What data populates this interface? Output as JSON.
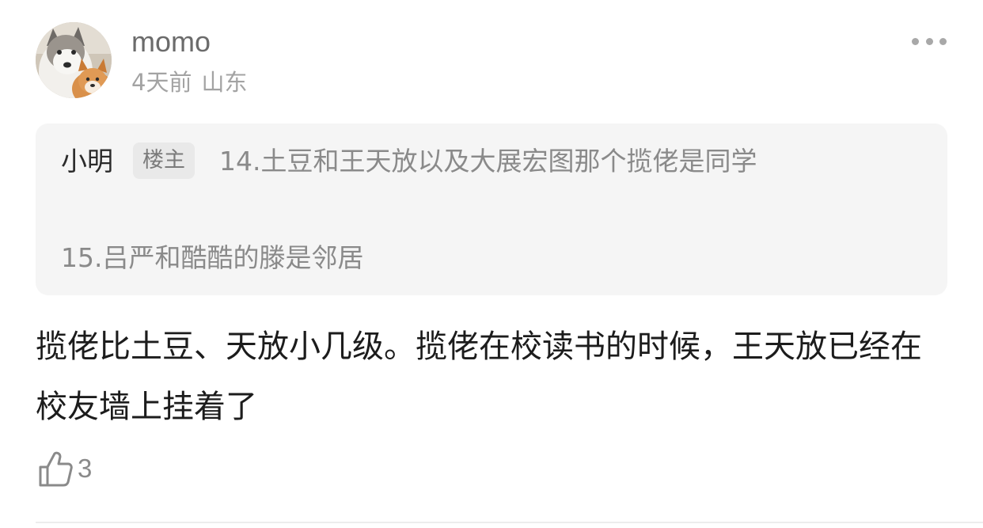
{
  "comment": {
    "username": "momo",
    "time": "4天前",
    "location": "山东",
    "quote": {
      "author": "小明",
      "badge": "楼主",
      "line1": "14.土豆和王天放以及大展宏图那个揽佬是同学",
      "line2": "15.吕严和酷酷的滕是邻居"
    },
    "text": "揽佬比土豆、天放小几级。揽佬在校读书的时候，王天放已经在校友墙上挂着了",
    "likes": "3"
  },
  "icons": {
    "avatar": "dog-avatar",
    "more": "more-dots-icon",
    "like": "thumbs-up-icon"
  },
  "colors": {
    "quote_bg": "#f5f5f5",
    "muted_text": "#a3a3a3"
  }
}
